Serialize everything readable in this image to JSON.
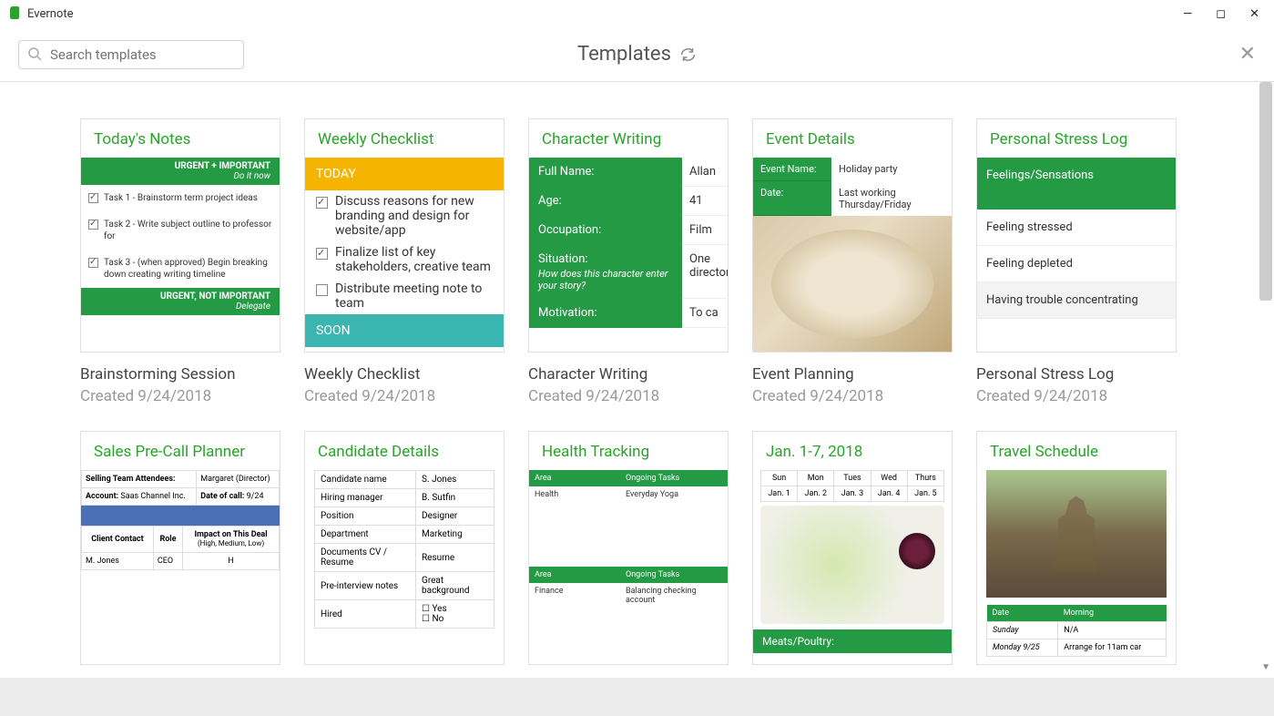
{
  "app": {
    "name": "Evernote"
  },
  "toolbar": {
    "title": "Templates",
    "search_placeholder": "Search templates"
  },
  "cards": [
    {
      "header": "Today's Notes",
      "title": "Brainstorming Session",
      "sub": "Created 9/24/2018",
      "tn": {
        "band1": {
          "line1": "URGENT + IMPORTANT",
          "line2": "Do it now"
        },
        "tasks": [
          "Task 1 - Brainstorm term project ideas",
          "Task 2 - Write subject outline to professor for",
          "Task 3 - (when approved) Begin breaking down creating writing timeline"
        ],
        "band2": {
          "line1": "URGENT, NOT IMPORTANT",
          "line2": "Delegate"
        }
      }
    },
    {
      "header": "Weekly Checklist",
      "title": "Weekly Checklist",
      "sub": "Created 9/24/2018",
      "wc": {
        "today": "TODAY",
        "soon": "SOON",
        "items": [
          {
            "t": "Discuss reasons for new branding and design for website/app",
            "c": true
          },
          {
            "t": "Finalize list of key stakeholders, creative team",
            "c": true
          },
          {
            "t": "Distribute meeting note to team",
            "c": false
          }
        ]
      }
    },
    {
      "header": "Character Writing",
      "title": "Character Writing",
      "sub": "Created 9/24/2018",
      "cw": [
        {
          "l": "Full Name:",
          "r": "Allan"
        },
        {
          "l": "Age:",
          "r": "41"
        },
        {
          "l": "Occupation:",
          "r": "Film"
        },
        {
          "l": "Situation:",
          "i": "How does this character enter your story?",
          "r": "One director"
        },
        {
          "l": "Motivation:",
          "r": "To ca"
        }
      ]
    },
    {
      "header": "Event Details",
      "title": "Event Planning",
      "sub": "Created 9/24/2018",
      "ev": [
        {
          "l": "Event Name:",
          "r": "Holiday party"
        },
        {
          "l": "Date:",
          "r": "Last working Thursday/Friday"
        }
      ]
    },
    {
      "header": "Personal Stress Log",
      "title": "Personal Stress Log",
      "sub": "Created 9/24/2018",
      "sl": {
        "head": "Feelings/Sensations",
        "rows": [
          "Feeling stressed",
          "Feeling depleted",
          "Having trouble concentrating"
        ]
      }
    },
    {
      "header": "Sales Pre-Call Planner",
      "title": "",
      "sub": "",
      "sp": {
        "r1": [
          "Selling Team Attendees:",
          "Margaret (Director)"
        ],
        "r2": [
          "Account: ",
          "Saas Channel Inc.",
          "Date of call: ",
          "9/24"
        ],
        "hdr": [
          "Client Contact",
          "Role",
          "Impact on This Deal"
        ],
        "hnote": "(High, Medium, Low)",
        "row": [
          "M. Jones",
          "CEO",
          "H"
        ]
      }
    },
    {
      "header": "Candidate Details",
      "title": "",
      "sub": "",
      "cd": [
        [
          "Candidate name",
          "S. Jones"
        ],
        [
          "Hiring manager",
          "B. Sutfin"
        ],
        [
          "Position",
          "Designer"
        ],
        [
          "Department",
          "Marketing"
        ],
        [
          "Documents CV / Resume",
          "Resume"
        ],
        [
          "Pre-interview notes",
          "Great background"
        ],
        [
          "Hired",
          "Yes / No"
        ]
      ]
    },
    {
      "header": "Health Tracking",
      "title": "",
      "sub": "",
      "ht": {
        "cols": [
          "Area",
          "Ongoing Tasks"
        ],
        "r1": [
          "Health",
          "Everyday Yoga"
        ],
        "r2": [
          "Finance",
          "Balancing checking account"
        ]
      }
    },
    {
      "header": "Jan. 1-7, 2018",
      "title": "",
      "sub": "",
      "mp": {
        "days": [
          "Sun",
          "Mon",
          "Tues",
          "Wed",
          "Thurs"
        ],
        "dates": [
          "Jan. 1",
          "Jan. 2",
          "Jan. 3",
          "Jan. 4",
          "Jan. 5"
        ],
        "band": "Meats/Poultry:"
      }
    },
    {
      "header": "Travel Schedule",
      "title": "",
      "sub": "",
      "tv": {
        "cols": [
          "Date",
          "Morning"
        ],
        "rows": [
          [
            "Sunday",
            "N/A"
          ],
          [
            "Monday 9/25",
            "Arrange for 11am car"
          ]
        ]
      }
    }
  ]
}
